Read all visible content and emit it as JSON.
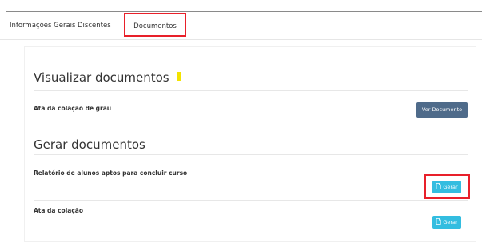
{
  "tabs": {
    "info_label": "Informações Gerais",
    "discentes_label": "Discentes",
    "documentos_label": "Documentos",
    "active": "Documentos"
  },
  "visualizar": {
    "title": "Visualizar documentos",
    "rows": [
      {
        "label": "Ata da colação de grau",
        "button_label": "Ver Documento"
      }
    ]
  },
  "gerar": {
    "title": "Gerar documentos",
    "rows": [
      {
        "label": "Relatório de alunos aptos para concluir curso",
        "button_label": "Gerar",
        "button_icon": "document-icon"
      },
      {
        "label": "Ata da colação",
        "button_label": "Gerar",
        "button_icon": "document-icon"
      }
    ]
  },
  "colors": {
    "ver_button": "#4f6b8a",
    "gerar_button": "#33bde0",
    "highlight_annotation": "#e8202a",
    "marker": "#f3e300"
  }
}
